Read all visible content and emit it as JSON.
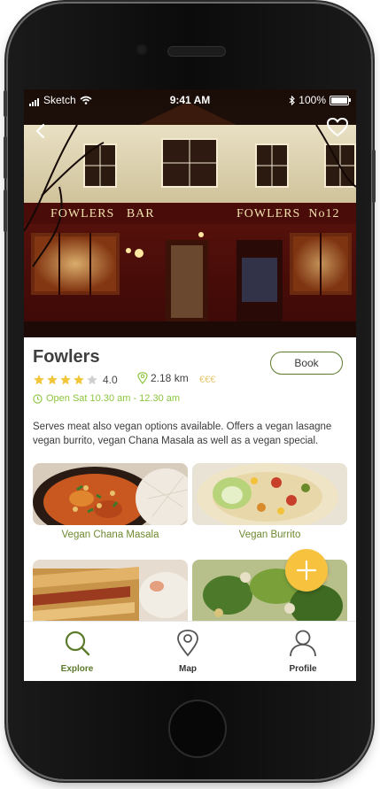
{
  "status_bar": {
    "carrier": "Sketch",
    "time": "9:41 AM",
    "battery": "100%"
  },
  "restaurant": {
    "name": "Fowlers",
    "rating": "4.0",
    "rating_value": 4,
    "rating_max": 5,
    "distance": "2.18 km",
    "price": "€€€",
    "hours": "Open Sat 10.30 am - 12.30 am",
    "description": "Serves meat also vegan options available. Offers a vegan lasagne vegan burrito, vegan Chana Masala as well as a vegan special.",
    "book_label": "Book",
    "sign_left": "FOWLERS   BAR",
    "sign_right": "FOWLERS  No12"
  },
  "dishes": [
    {
      "label": "Vegan Chana Masala"
    },
    {
      "label": "Vegan Burrito"
    },
    {
      "label": ""
    },
    {
      "label": ""
    }
  ],
  "tabs": [
    {
      "label": "Explore",
      "active": true
    },
    {
      "label": "Map",
      "active": false
    },
    {
      "label": "Profile",
      "active": false
    }
  ],
  "colors": {
    "accent_green": "#5b7a2b",
    "open_green": "#8cc63e",
    "star_gold": "#f2c63b",
    "fab_yellow": "#f7c33e",
    "price_gold": "#e6c66e"
  },
  "icons": {
    "back": "chevron-left-icon",
    "favorite": "heart-icon",
    "distance": "location-pin-icon",
    "hours": "clock-icon",
    "fab": "plus-icon",
    "explore": "search-icon",
    "map": "map-pin-icon",
    "profile": "user-icon"
  }
}
